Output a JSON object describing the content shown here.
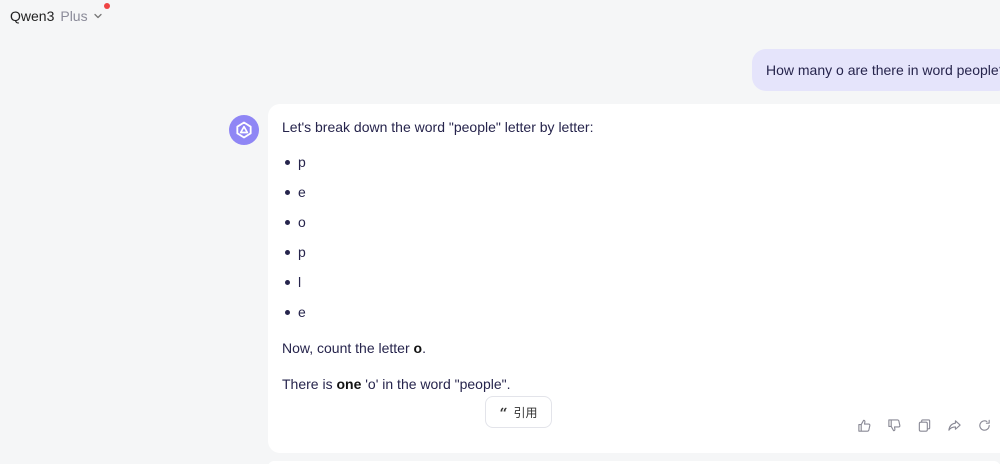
{
  "header": {
    "model_name": "Qwen3",
    "model_tier": "Plus",
    "dropdown_icon": "chevron-down-icon",
    "notification_color": "#ef4444"
  },
  "conversation": {
    "user_message": "How many o are there in word people?",
    "assistant": {
      "avatar_icon": "qwen-logo-icon",
      "intro": "Let's break down the word \"people\" letter by letter:",
      "letters": [
        "p",
        "e",
        "o",
        "p",
        "l",
        "e"
      ],
      "count_prefix": "Now, count the letter ",
      "count_bold": "o",
      "count_suffix": ".",
      "answer_prefix": "There is ",
      "answer_bold": "one",
      "answer_suffix": " 'o' in the word \"people\".",
      "quote_button_label": "引用"
    },
    "actions": [
      "thumbs-up-icon",
      "thumbs-down-icon",
      "copy-icon",
      "share-icon",
      "regenerate-icon"
    ]
  },
  "colors": {
    "user_bubble": "#e5e4fb",
    "avatar": "#8f86f5",
    "background": "#f5f6f7"
  }
}
